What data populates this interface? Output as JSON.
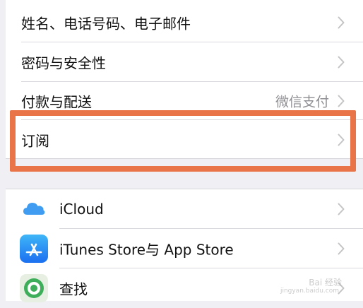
{
  "settings": {
    "account_rows": [
      {
        "label": "姓名、电话号码、电子邮件",
        "value": ""
      },
      {
        "label": "密码与安全性",
        "value": ""
      },
      {
        "label": "付款与配送",
        "value": "微信支付"
      },
      {
        "label": "订阅",
        "value": ""
      }
    ],
    "service_rows": [
      {
        "label": "iCloud",
        "icon": "icloud-icon"
      },
      {
        "label": "iTunes Store与 App Store",
        "icon": "app-store-icon"
      },
      {
        "label": "查找",
        "icon": "find-my-icon"
      }
    ]
  },
  "colors": {
    "highlight": "#e87448",
    "background": "#efeff4",
    "chevron": "#c4c4c7",
    "icloud_blue": "#3f9cf0",
    "app_store_blue": "#1b7cf0",
    "find_my_green": "#3fae5a"
  },
  "watermark": {
    "text": "Bai 经验",
    "sub": "jingyan.baidu.com"
  }
}
